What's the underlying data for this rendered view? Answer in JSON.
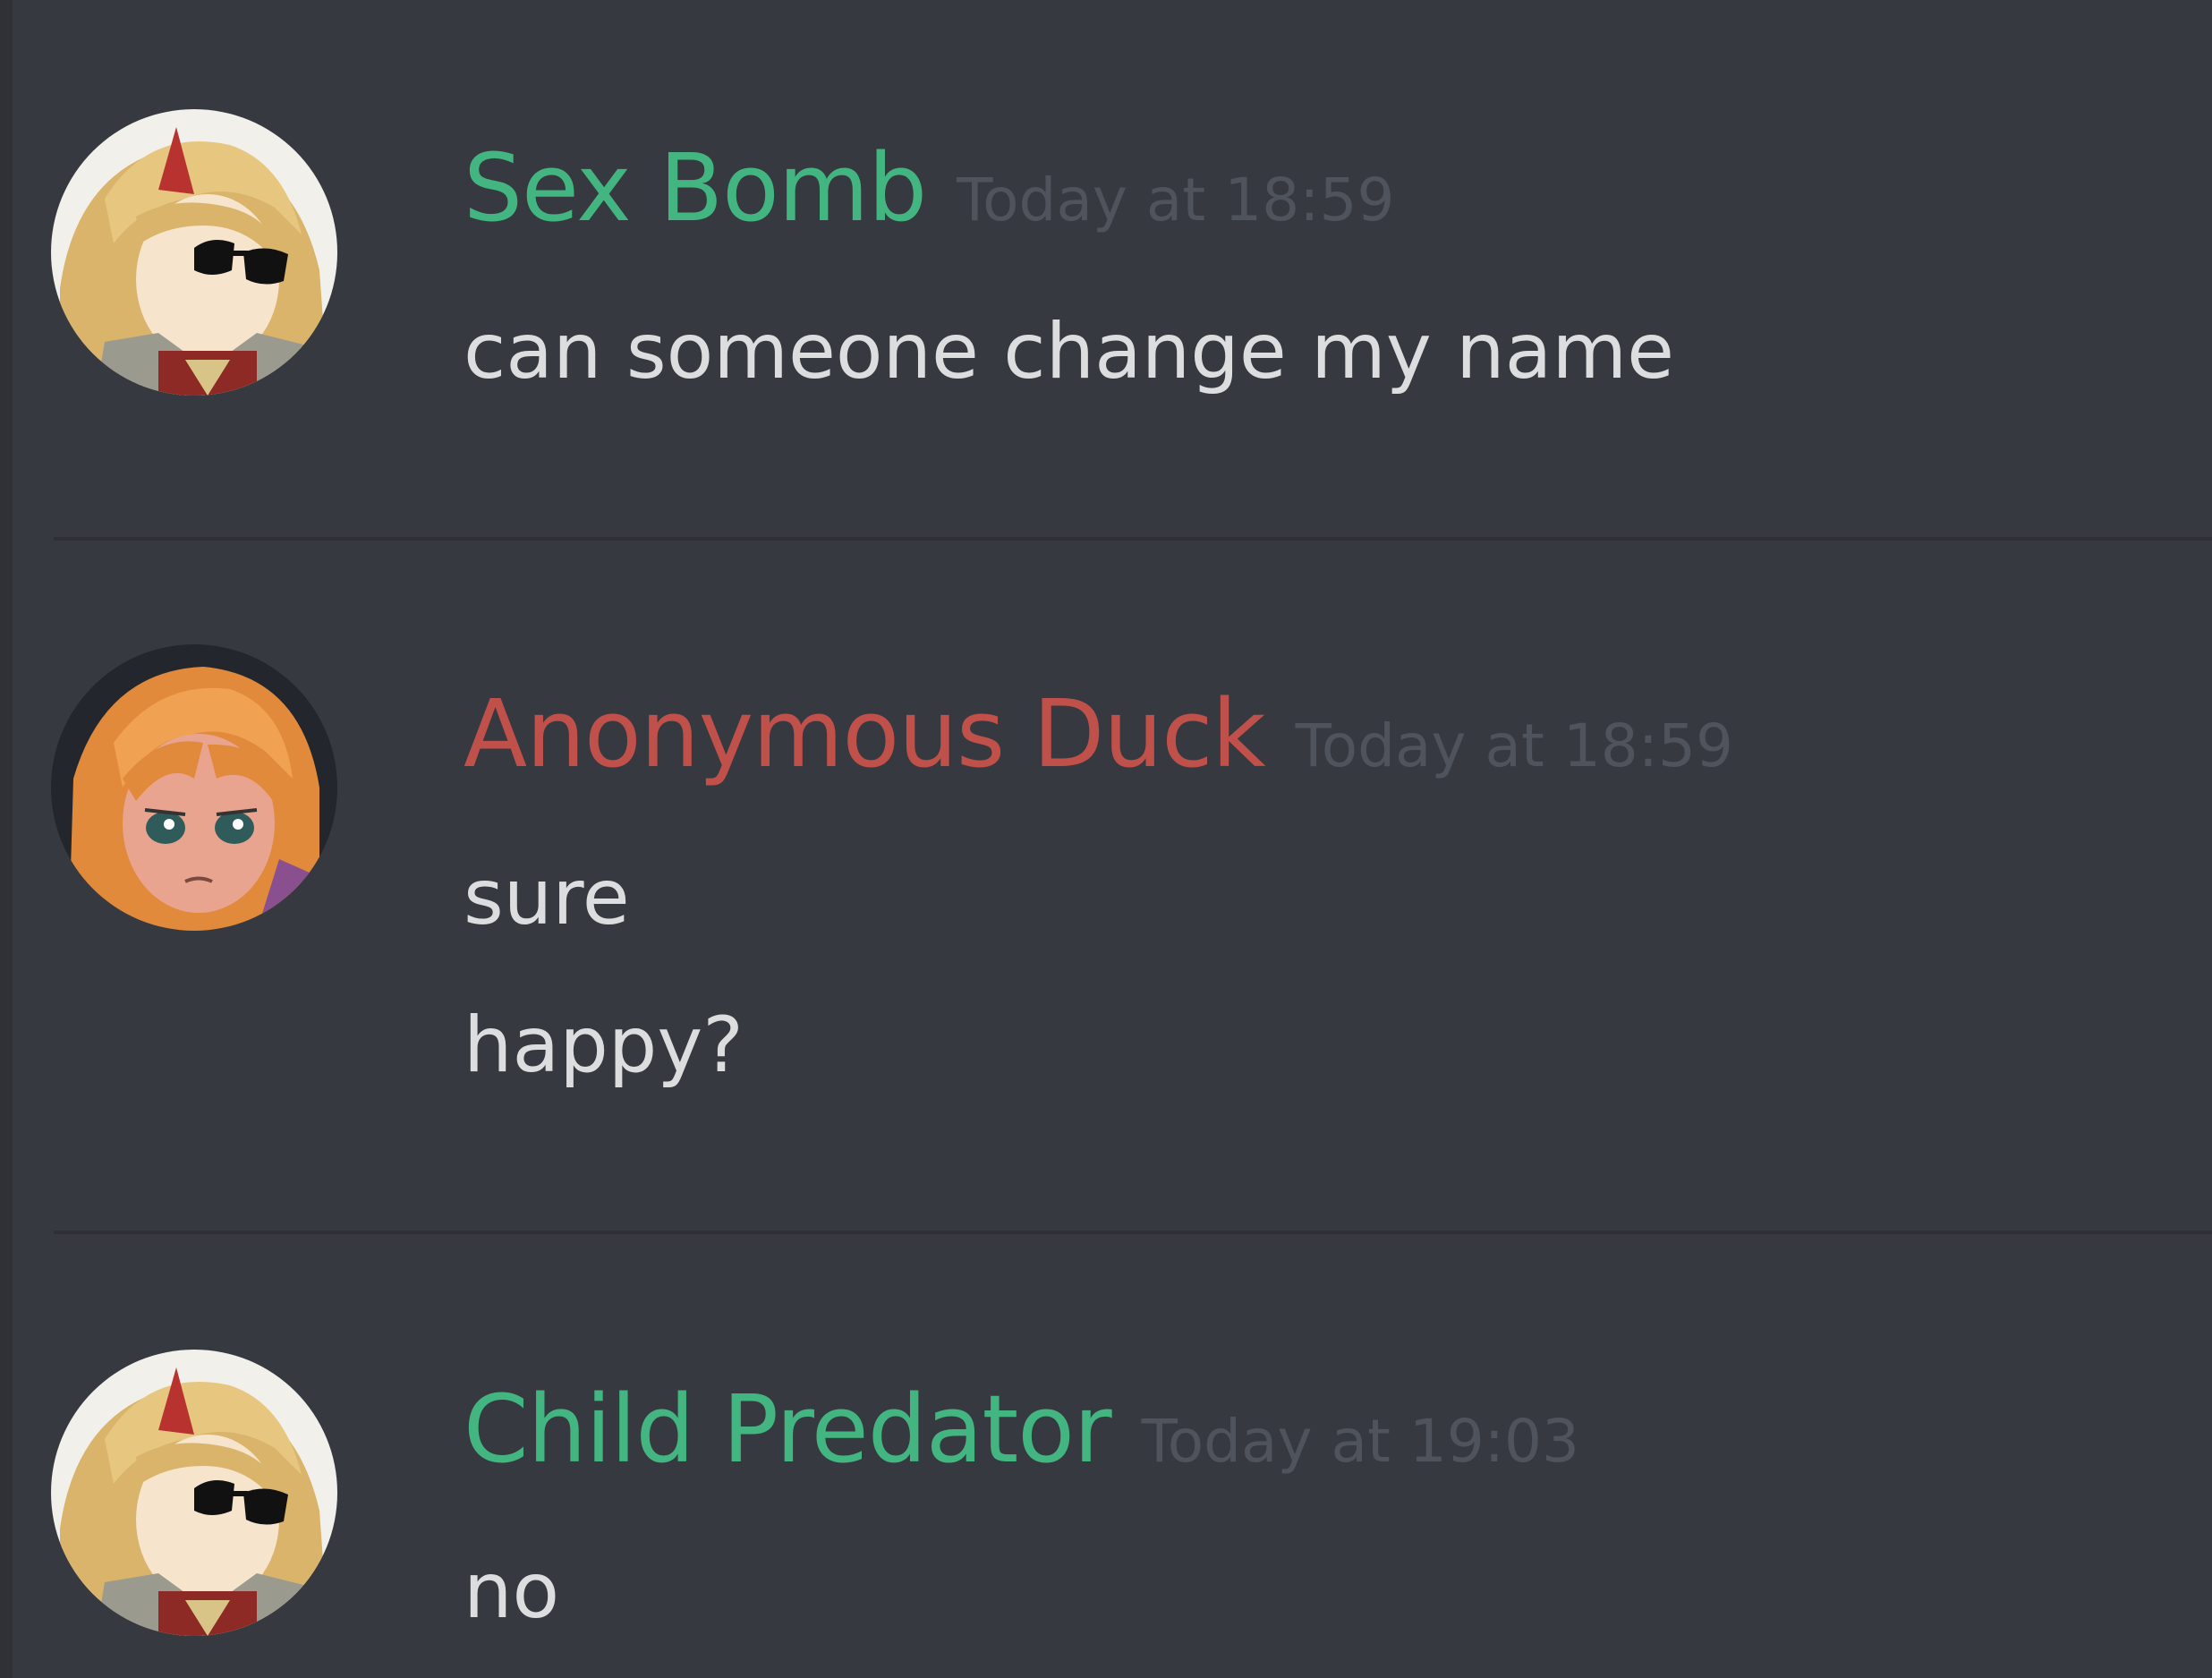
{
  "messages": [
    {
      "username": "Sex Bomb",
      "username_color": "#43b581",
      "timestamp": "Today at 18:59",
      "avatar_icon": "anime-avatar-sunglasses-icon",
      "lines": [
        "can someone change my name"
      ]
    },
    {
      "username": "Anonymous Duck",
      "username_color": "#c0504a",
      "timestamp": "Today at 18:59",
      "avatar_icon": "anime-avatar-orange-hair-icon",
      "lines": [
        "sure",
        "happy?"
      ]
    },
    {
      "username": "Child Predator",
      "username_color": "#43b581",
      "timestamp": "Today at 19:03",
      "avatar_icon": "anime-avatar-sunglasses-icon",
      "lines": [
        "no"
      ]
    }
  ],
  "colors": {
    "background": "#363940",
    "message_text": "#dcddde",
    "timestamp": "#4f535b",
    "divider": "#2e3035"
  }
}
